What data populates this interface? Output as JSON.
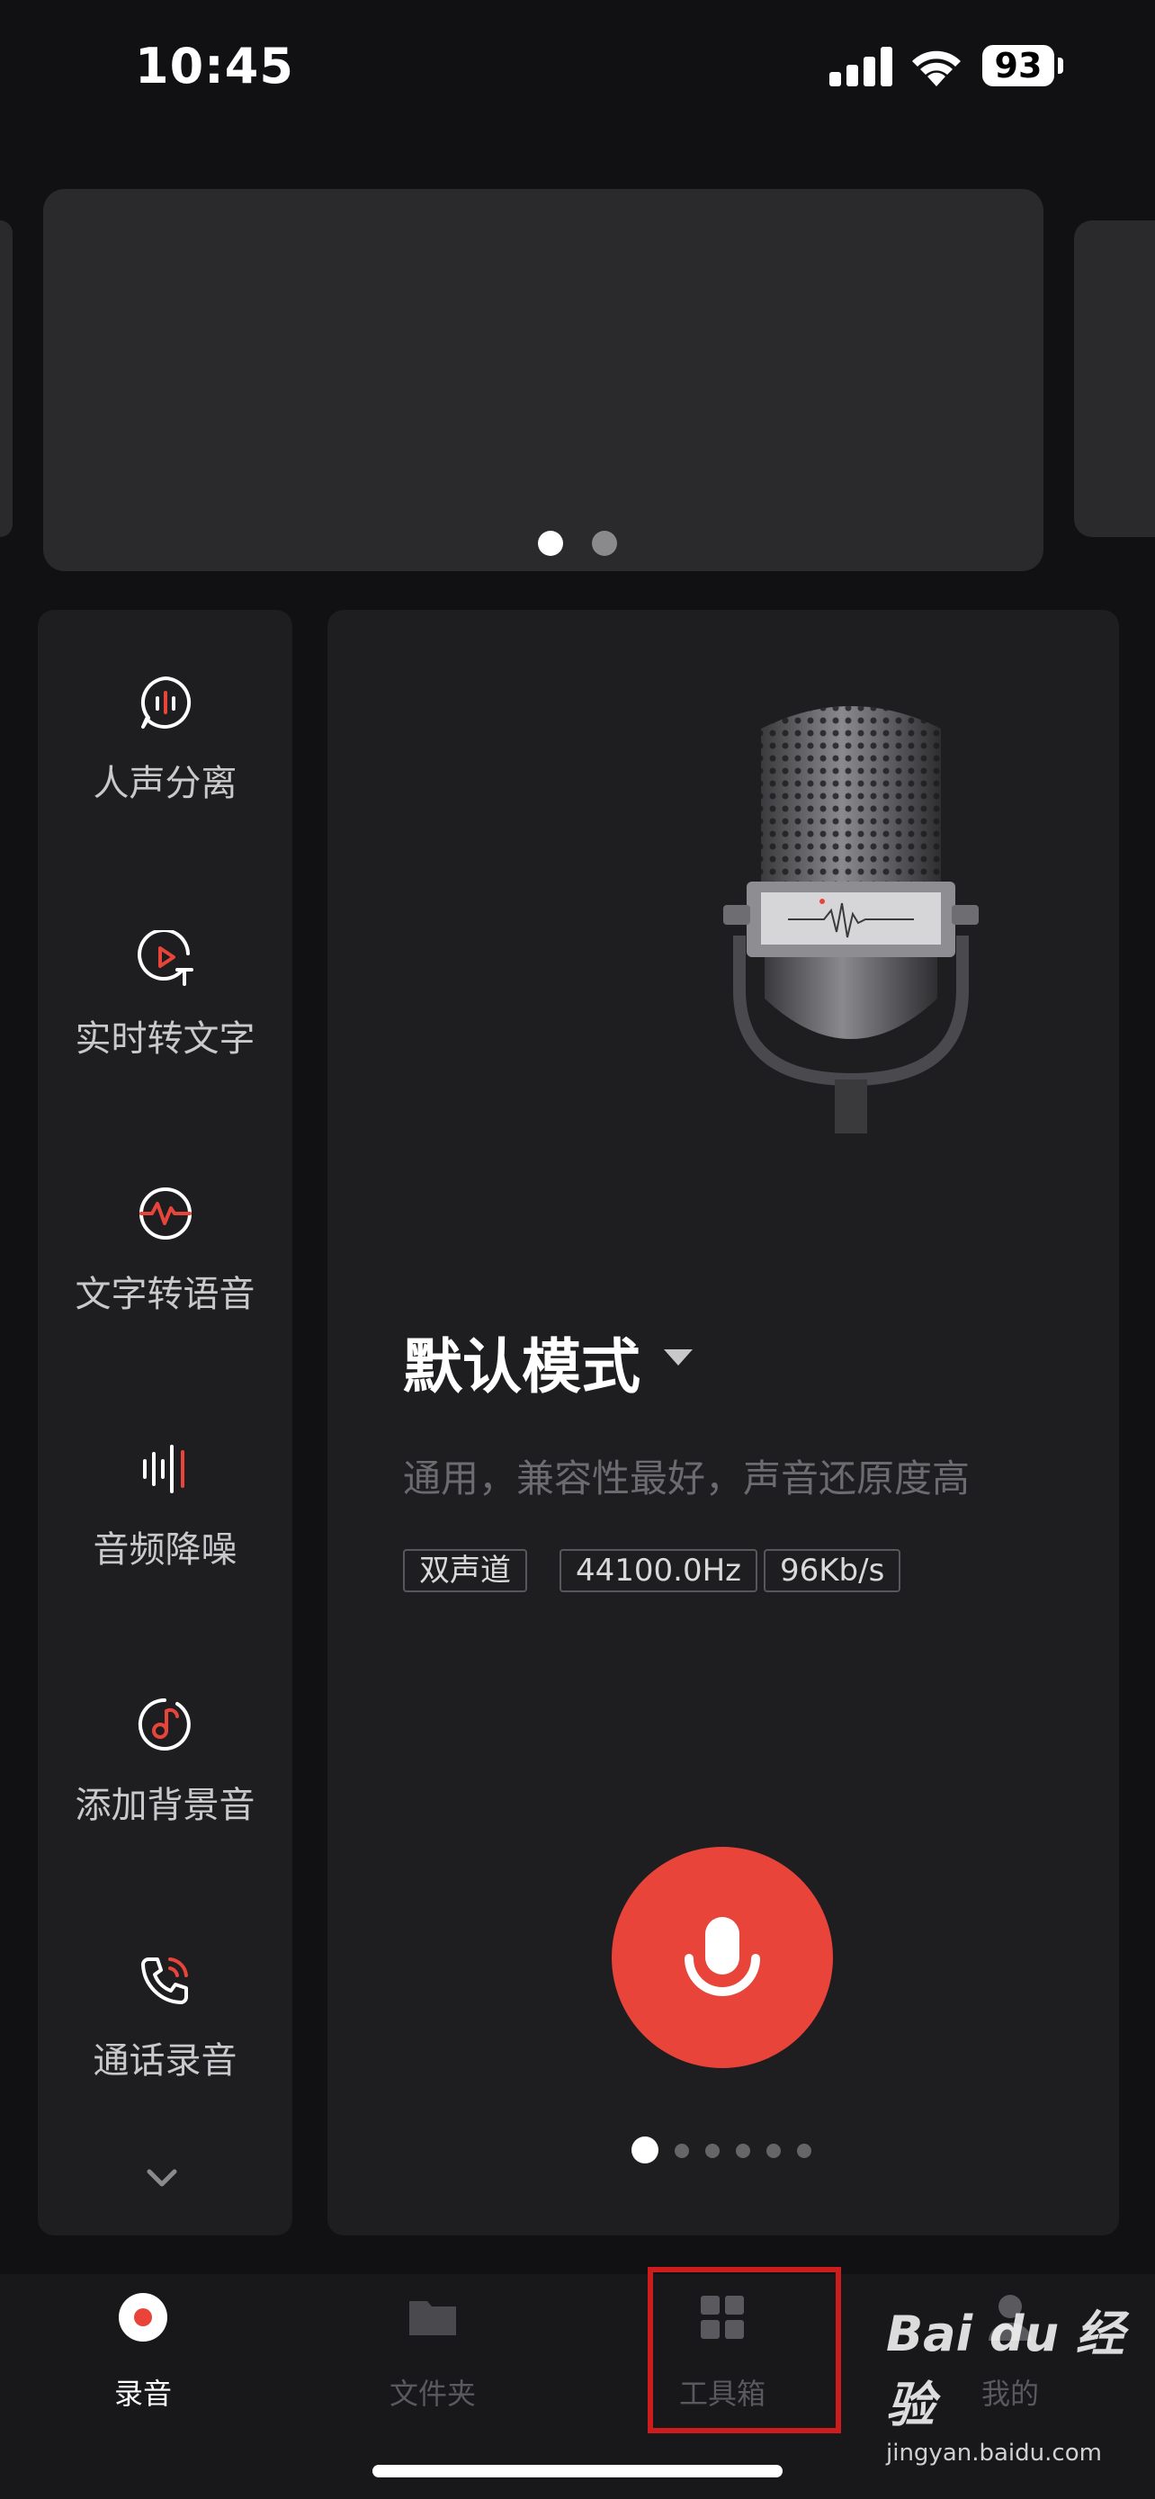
{
  "status_bar": {
    "time": "10:45",
    "battery": "93"
  },
  "tools": [
    {
      "label": "人声分离",
      "icon": "voice-separation-icon"
    },
    {
      "label": "实时转文字",
      "icon": "live-transcribe-icon"
    },
    {
      "label": "文字转语音",
      "icon": "text-to-speech-icon"
    },
    {
      "label": "音频降噪",
      "icon": "noise-reduction-icon"
    },
    {
      "label": "添加背景音",
      "icon": "background-music-icon"
    },
    {
      "label": "通话录音",
      "icon": "call-recording-icon"
    }
  ],
  "mode": {
    "title": "默认模式",
    "description": "通用，兼容性最好，声音还原度高",
    "tags": [
      "双声道",
      "44100.0Hz",
      "96Kb/s"
    ]
  },
  "tabs": [
    {
      "label": "录音",
      "icon": "record-icon",
      "active": true
    },
    {
      "label": "文件夹",
      "icon": "folder-icon",
      "active": false
    },
    {
      "label": "工具箱",
      "icon": "toolbox-icon",
      "active": false
    },
    {
      "label": "我的",
      "icon": "profile-icon",
      "active": false
    }
  ],
  "watermark": {
    "main": "Bai du 经验",
    "sub": "jingyan.baidu.com"
  },
  "colors": {
    "accent": "#e8443a",
    "background": "#111114",
    "card": "#1e1e21",
    "highlight": "#cc1c1c"
  }
}
